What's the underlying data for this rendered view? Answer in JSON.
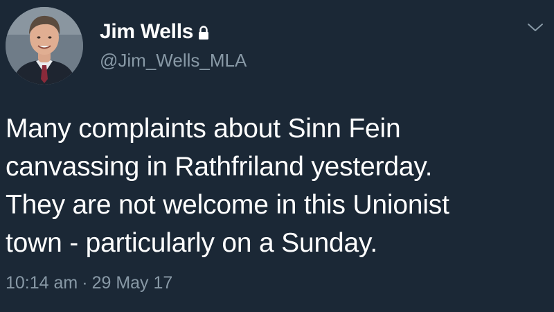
{
  "tweet": {
    "display_name": "Jim Wells",
    "handle": "@Jim_Wells_MLA",
    "text": "Many complaints about Sinn Fein\ncanvassing in Rathfriland yesterday.\nThey are not welcome in this Unionist\ntown - particularly on a Sunday.",
    "time": "10:14 am",
    "separator": "·",
    "date": "29 May 17",
    "protected_icon": "lock-icon",
    "menu_icon": "chevron-down-icon"
  },
  "colors": {
    "background": "#1b2836",
    "primary_text": "#ffffff",
    "secondary_text": "#8899a6"
  }
}
